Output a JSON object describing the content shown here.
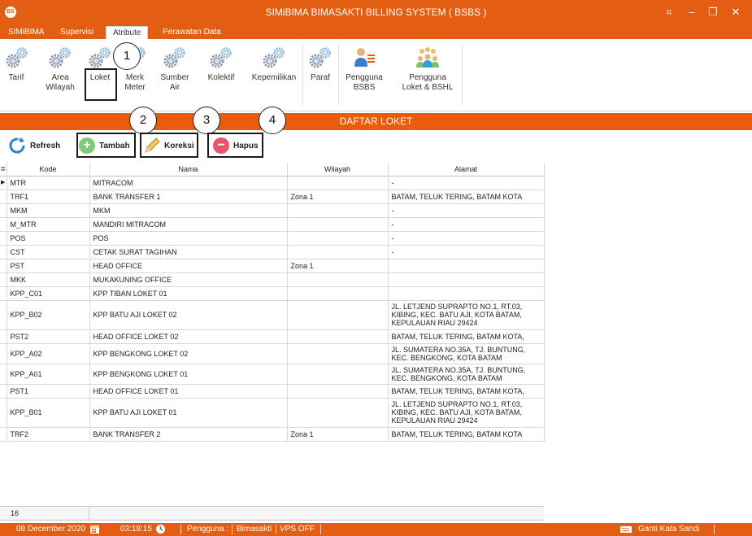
{
  "app": {
    "logo_text": "BS",
    "title": "SIMiBIMA BIMASAKTI BILLING SYSTEM ( BSBS )"
  },
  "tabs": [
    {
      "label": "SIMiBIMA"
    },
    {
      "label": "Supervisi"
    },
    {
      "label": "Atribute",
      "active": true
    },
    {
      "label": "Perawatan Data"
    }
  ],
  "ribbon": {
    "items": [
      {
        "label": "Tarif"
      },
      {
        "label": "Area\nWilayah"
      },
      {
        "label": "Loket",
        "highlighted": true
      },
      {
        "label": "Merk\nMeter"
      },
      {
        "label": "Sumber\nAir"
      },
      {
        "label": "Kolektif"
      },
      {
        "label": "Kepemilikan"
      },
      {
        "label": "Paraf"
      },
      {
        "label": "Pengguna\nBSBS"
      },
      {
        "label": "Pengguna\nLoket & BSHL"
      }
    ]
  },
  "section": {
    "title": "DAFTAR LOKET"
  },
  "toolbar": {
    "refresh": "Refresh",
    "add": "Tambah",
    "edit": "Koreksi",
    "delete": "Hapus"
  },
  "grid": {
    "columns": [
      "Kode",
      "Nama",
      "Wilayah",
      "Alamat"
    ],
    "rows": [
      {
        "kode": "MTR",
        "nama": "MITRACOM",
        "wilayah": "",
        "alamat": "-",
        "current": true
      },
      {
        "kode": "TRF1",
        "nama": "BANK TRANSFER 1",
        "wilayah": "Zona 1",
        "alamat": "BATAM, TELUK TERING, BATAM KOTA"
      },
      {
        "kode": "MKM",
        "nama": "MKM",
        "wilayah": "",
        "alamat": "-"
      },
      {
        "kode": "M_MTR",
        "nama": "MANDIRI MITRACOM",
        "wilayah": "",
        "alamat": "-"
      },
      {
        "kode": "POS",
        "nama": "POS",
        "wilayah": "",
        "alamat": "-"
      },
      {
        "kode": "CST",
        "nama": "CETAK SURAT TAGIHAN",
        "wilayah": "",
        "alamat": "-"
      },
      {
        "kode": "PST",
        "nama": "HEAD OFFICE",
        "wilayah": "Zona 1",
        "alamat": ""
      },
      {
        "kode": "MKK",
        "nama": "MUKAKUNING OFFICE",
        "wilayah": "",
        "alamat": ""
      },
      {
        "kode": "KPP_C01",
        "nama": "KPP TIBAN LOKET 01",
        "wilayah": "",
        "alamat": ""
      },
      {
        "kode": "KPP_B02",
        "nama": "KPP BATU AJI LOKET 02",
        "wilayah": "",
        "alamat": "JL. LETJEND SUPRAPTO NO.1, RT.03,\nKIBING, KEC. BATU AJI, KOTA BATAM,\nKEPULAUAN RIAU 29424"
      },
      {
        "kode": "PST2",
        "nama": "HEAD OFFICE LOKET 02",
        "wilayah": "",
        "alamat": "BATAM, TELUK TERING, BATAM KOTA,"
      },
      {
        "kode": "KPP_A02",
        "nama": "KPP BENGKONG LOKET 02",
        "wilayah": "",
        "alamat": "JL. SUMATERA NO.35A, TJ. BUNTUNG,\nKEC. BENGKONG, KOTA BATAM"
      },
      {
        "kode": "KPP_A01",
        "nama": "KPP BENGKONG LOKET 01",
        "wilayah": "",
        "alamat": "JL. SUMATERA NO.35A, TJ. BUNTUNG,\nKEC. BENGKONG, KOTA BATAM"
      },
      {
        "kode": "PST1",
        "nama": "HEAD OFFICE LOKET 01",
        "wilayah": "",
        "alamat": "BATAM, TELUK TERING, BATAM KOTA,"
      },
      {
        "kode": "KPP_B01",
        "nama": "KPP BATU AJI LOKET 01",
        "wilayah": "",
        "alamat": "JL. LETJEND SUPRAPTO NO.1, RT.03,\nKIBING, KEC. BATU AJI, KOTA BATAM,\nKEPULAUAN RIAU 29424"
      },
      {
        "kode": "TRF2",
        "nama": "BANK TRANSFER 2",
        "wilayah": "Zona 1",
        "alamat": "BATAM, TELUK TERING, BATAM KOTA"
      }
    ],
    "row_count": "16"
  },
  "callouts": [
    "1",
    "2",
    "3",
    "4"
  ],
  "status": {
    "date": "08 December 2020",
    "time": "03:18:15",
    "user_label": "Pengguna :",
    "user_value": "Bimasakti",
    "vps": "VPS OFF",
    "change_password": "Ganti Kata Sandi"
  },
  "colors": {
    "brand": "#e35d12",
    "header_bar": "#ea5b0c",
    "add_icon": "#7dc87a",
    "delete_icon": "#e8546a",
    "refresh_icon": "#2f7fd1"
  },
  "icons": {
    "ribbon": "gears-icon",
    "user": "user-icon",
    "group": "users-group-icon"
  }
}
